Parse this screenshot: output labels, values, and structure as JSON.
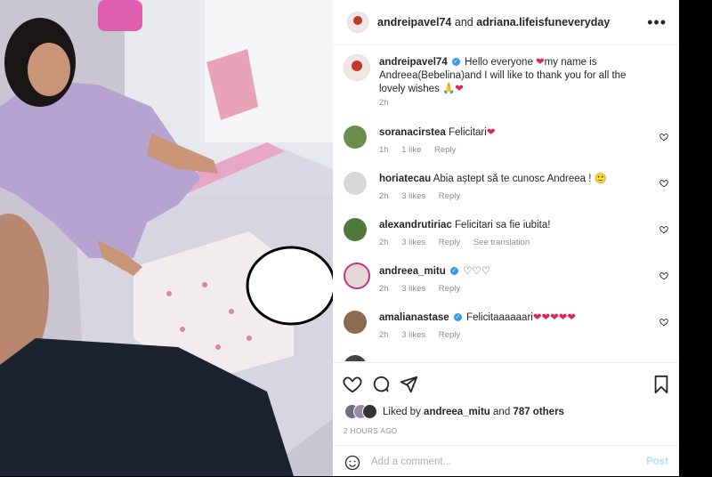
{
  "post": {
    "author": "andreipavel74",
    "and_word": "and",
    "coauthor": "adriana.lifeisfuneveryday",
    "more_label": "•••"
  },
  "caption": {
    "user": "andreipavel74",
    "part1": "Hello everyone ",
    "part2": "my name is Andreea(Bebelina)and I will like to thank you for all the lovely wishes ",
    "time": "2h"
  },
  "comments": [
    {
      "user": "soranacirstea",
      "text": "Felicitari",
      "verified": false,
      "hearts": 1,
      "time": "1h",
      "likes": "1 like",
      "reply": "Reply",
      "translate": "",
      "avatar_color": "#6b8e4e"
    },
    {
      "user": "horiatecau",
      "text": "Abia aștept să te cunosc Andreea ! ",
      "verified": false,
      "hearts": 0,
      "time": "2h",
      "likes": "3 likes",
      "reply": "Reply",
      "translate": "",
      "avatar_color": "#d8d8d8"
    },
    {
      "user": "alexandrutiriac",
      "text": "Felicitari sa fie iubita!",
      "verified": false,
      "hearts": 0,
      "time": "2h",
      "likes": "3 likes",
      "reply": "Reply",
      "translate": "See translation",
      "avatar_color": "#4f7a3a"
    },
    {
      "user": "andreea_mitu",
      "text": "♡♡♡",
      "verified": true,
      "hearts": 0,
      "time": "2h",
      "likes": "3 likes",
      "reply": "Reply",
      "translate": "",
      "avatar_color": "#c13584"
    },
    {
      "user": "amalianastase",
      "text": "Felicitaaaaaari",
      "verified": true,
      "hearts": 5,
      "time": "2h",
      "likes": "3 likes",
      "reply": "Reply",
      "translate": "",
      "avatar_color": "#8a6b52"
    }
  ],
  "likes": {
    "prefix": "Liked by",
    "user": "andreea_mitu",
    "joiner": "and",
    "others": "787 others"
  },
  "date": "2 HOURS AGO",
  "add_comment": {
    "placeholder": "Add a comment...",
    "post_label": "Post"
  },
  "icons": {
    "heart": "heart-icon",
    "comment": "comment-icon",
    "share": "share-icon",
    "save": "bookmark-icon",
    "emoji": "emoji-icon",
    "verified": "verified-icon"
  },
  "colors": {
    "heart_red": "#e0245e",
    "verified_blue": "#3897f0",
    "muted": "#8e8e8e",
    "post_button": "#b2dffc"
  }
}
